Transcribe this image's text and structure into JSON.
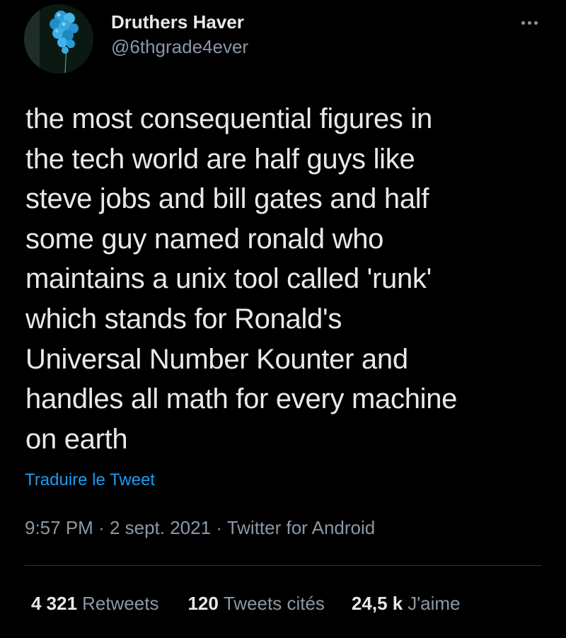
{
  "tweet": {
    "author": {
      "display_name": "Druthers Haver",
      "handle": "@6thgrade4ever",
      "avatar_icon": "balloon-cluster-avatar"
    },
    "more_icon": "more-dots-icon",
    "body_lines": [
      "the most consequential figures in",
      "the tech world are half guys like",
      "steve jobs and bill gates and half",
      "some guy named ronald who",
      "maintains a unix tool called 'runk'",
      "which stands for Ronald's",
      "Universal Number Kounter and",
      "handles all math for every machine",
      "on earth"
    ],
    "translate_label": "Traduire le Tweet",
    "time": "9:57 PM",
    "separator": " · ",
    "date": "2 sept. 2021",
    "source": "Twitter for Android",
    "stats": {
      "retweets_count": "4 321",
      "retweets_label": "Retweets",
      "quotes_count": "120",
      "quotes_label": "Tweets cités",
      "likes_count": "24,5 k",
      "likes_label": "J'aime"
    }
  },
  "colors": {
    "background": "#000000",
    "text_primary": "#e7e9ea",
    "text_secondary": "#8b98a5",
    "link": "#1d9bf0",
    "divider": "#2f3336"
  }
}
